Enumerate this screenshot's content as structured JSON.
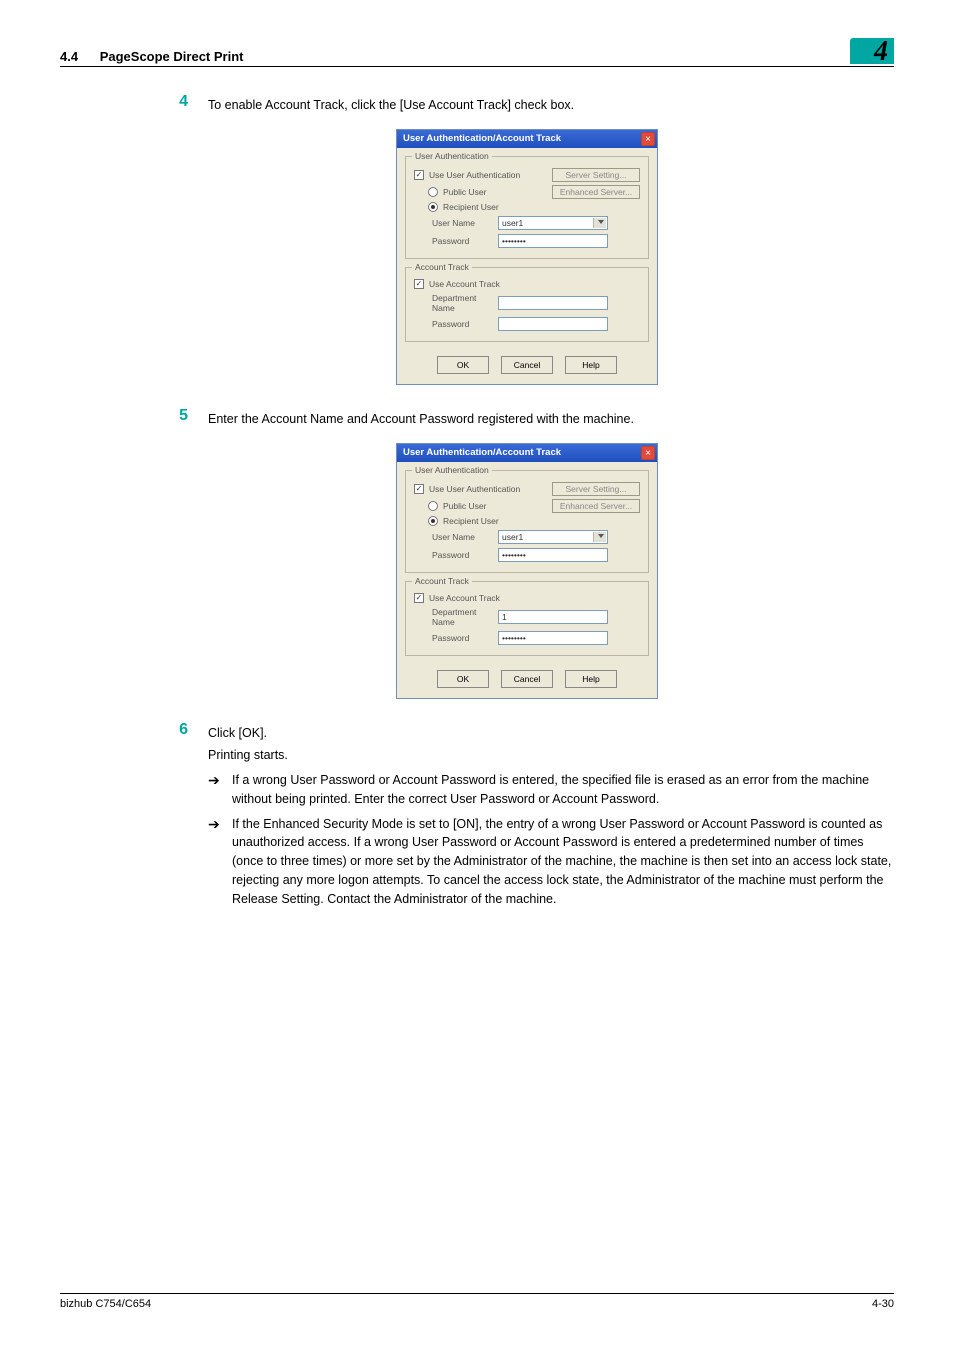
{
  "header": {
    "section_num": "4.4",
    "section_title": "PageScope Direct Print",
    "chapter_num": "4"
  },
  "steps": {
    "s4": {
      "num": "4",
      "text": "To enable Account Track, click the [Use Account Track] check box."
    },
    "s5": {
      "num": "5",
      "text": "Enter the Account Name and Account Password registered with the machine."
    },
    "s6": {
      "num": "6",
      "text": "Click [OK].",
      "line2": "Printing starts.",
      "bullets": [
        "If a wrong User Password or Account Password is entered, the specified file is erased as an error from the machine without being printed. Enter the correct User Password or Account Password.",
        "If the Enhanced Security Mode is set to [ON], the entry of a wrong User Password or Account Password is counted as unauthorized access. If a wrong User Password or Account Password is entered a predetermined number of times (once to three times) or more set by the Administrator of the machine, the machine is then set into an access lock state, rejecting any more logon attempts. To cancel the access lock state, the Administrator of the machine must perform the Release Setting. Contact the Administrator of the machine."
      ]
    }
  },
  "dialog": {
    "title": "User Authentication/Account Track",
    "group_auth": "User Authentication",
    "use_user_auth": "Use User Authentication",
    "server_setting": "Server Setting...",
    "public_user": "Public User",
    "enhanced_server": "Enhanced Server...",
    "recipient_user": "Recipient User",
    "user_name_label": "User Name",
    "user_name_value": "user1",
    "password_label": "Password",
    "password_mask": "••••••••",
    "group_acct": "Account Track",
    "use_account_track": "Use Account Track",
    "department_name_label": "Department Name",
    "department_name_value_b": "1",
    "btn_ok": "OK",
    "btn_cancel": "Cancel",
    "btn_help": "Help"
  },
  "footer": {
    "left": "bizhub C754/C654",
    "right": "4-30"
  }
}
